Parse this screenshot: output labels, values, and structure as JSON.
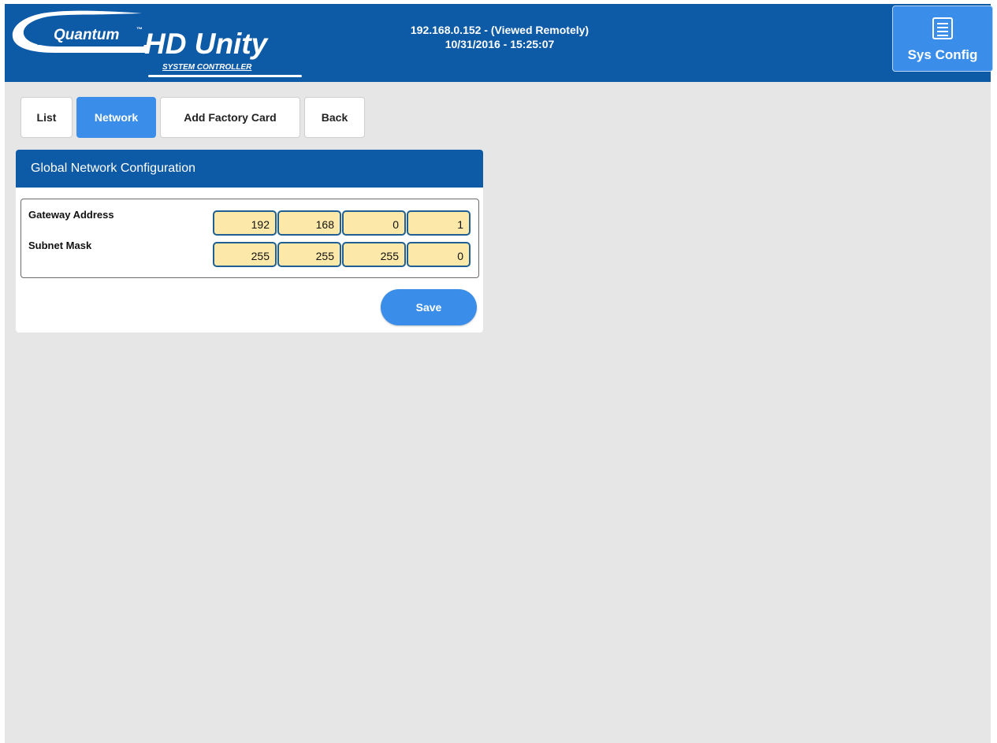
{
  "colors": {
    "header_bg": "#0d5aa7",
    "accent": "#3a8ee9",
    "field_bg": "#fce9a9",
    "page_bg": "#e6e6e6"
  },
  "logo": {
    "brand": "Quantum",
    "tm": "™",
    "product": "HD Unity",
    "subtitle": "SYSTEM CONTROLLER"
  },
  "header": {
    "address": "192.168.0.152 - (Viewed Remotely)",
    "datetime": "10/31/2016 - 15:25:07",
    "sys_config_label": "Sys Config",
    "sys_config_icon": "list-document-icon"
  },
  "tabs": [
    {
      "label": "List",
      "active": false
    },
    {
      "label": "Network",
      "active": true
    },
    {
      "label": "Add Factory Card",
      "active": false
    },
    {
      "label": "Back",
      "active": false
    }
  ],
  "panel": {
    "title": "Global Network Configuration",
    "gateway": {
      "label": "Gateway Address",
      "octets": [
        "192",
        "168",
        "0",
        "1"
      ]
    },
    "subnet": {
      "label": "Subnet Mask",
      "octets": [
        "255",
        "255",
        "255",
        "0"
      ]
    },
    "save_label": "Save"
  }
}
